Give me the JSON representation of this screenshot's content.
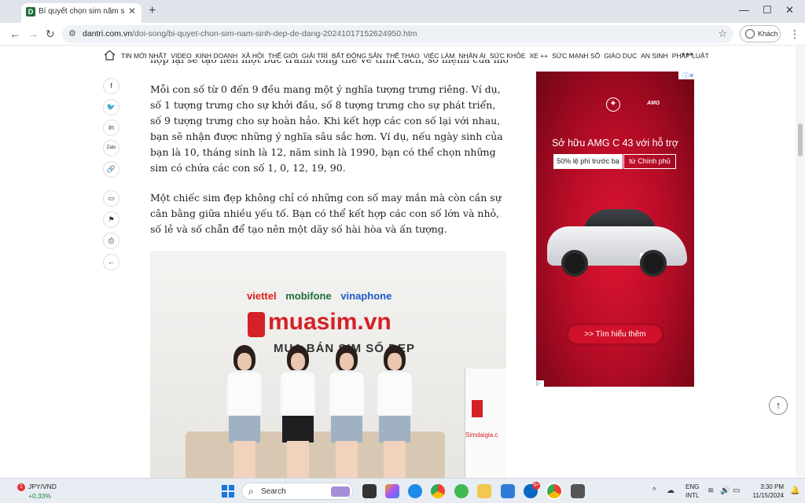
{
  "browser": {
    "tab_title": "Bí quyết chọn sim năm sinh đẹp",
    "favicon_letter": "D",
    "url_domain": "dantri.com.vn",
    "url_path": "/doi-song/bi-quyet-chon-sim-nam-sinh-dep-de-dang-20241017152624950.htm",
    "profile_label": "Khách"
  },
  "site_nav": {
    "items": [
      "TIN MỚI NHẤT",
      "VIDEO",
      "KINH DOANH",
      "XÃ HỘI",
      "THẾ GIỚI",
      "GIẢI TRÍ",
      "BẤT ĐỘNG SẢN",
      "THỂ THAO",
      "VIỆC LÀM",
      "NHÂN ÁI",
      "SỨC KHỎE",
      "XE ++",
      "SỨC MẠNH SỐ",
      "GIÁO DỤC",
      "AN SINH",
      "PHÁP LUẬT"
    ]
  },
  "social_rail": {
    "zalo_label": "Zalo"
  },
  "article": {
    "cut_line": "hợp lại sẽ tạo nên một bức tranh tổng thể về tính cách, số mệnh của mỗi người.",
    "paragraph_1": "Mỗi con số từ 0 đến 9 đều mang một ý nghĩa tượng trưng riêng. Ví dụ, số 1 tượng trưng cho sự khởi đầu, số 8 tượng trưng cho sự phát triển, số 9 tượng trưng cho sự hoàn hảo. Khi kết hợp các con số lại với nhau, bạn sẽ nhận được những ý nghĩa sâu sắc hơn. Ví dụ, nếu ngày sinh của bạn là 10, tháng sinh là 12, năm sinh là 1990, bạn có thể chọn những sim có chứa các con số 1, 0, 12, 19, 90.",
    "paragraph_2": "Một chiếc sim đẹp không chỉ có những con số may mắn mà còn cần sự cân bằng giữa nhiều yếu tố. Bạn có thể kết hợp các con số lớn và nhỏ, số lẻ và số chẵn để tạo nên một dãy số hài hòa và ấn tượng.",
    "photo": {
      "carrier_1": "viettel",
      "carrier_2": "mobifone",
      "carrier_3": "vinaphone",
      "brand": "muasim.vn",
      "tagline": "MUA BÁN SIM SỐ ĐẸP",
      "desk_text": "Simdaigia.c"
    }
  },
  "ad": {
    "amg_mark": "AMG",
    "headline": "Sở hữu AMG C 43 với hỗ trợ",
    "offer_left": "50% lệ phí trước bạ",
    "offer_right": "từ Chính phủ",
    "cta": ">> Tìm hiểu thêm",
    "colors": {
      "background": "#c20f2b",
      "cta": "#d1112b"
    }
  },
  "taskbar": {
    "currency_pair": "JPY/VND",
    "currency_change": "+0,33%",
    "weather_badge": "1",
    "search_label": "Search",
    "notification_badge": "9+",
    "lang_line1": "ENG",
    "lang_line2": "INTL",
    "time": "3:30 PM",
    "date": "11/15/2024"
  }
}
